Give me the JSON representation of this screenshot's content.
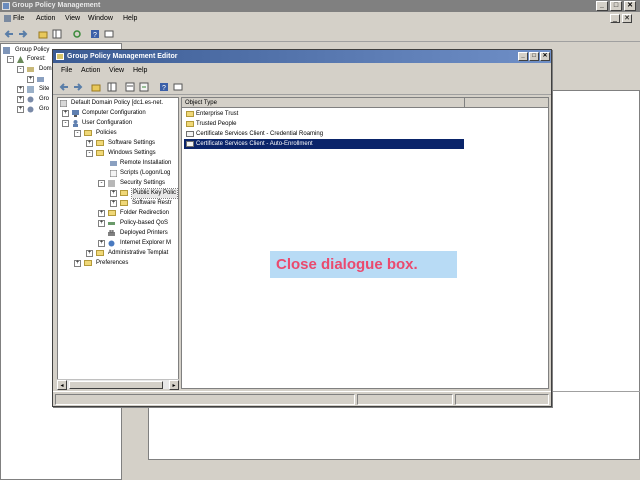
{
  "outer_window": {
    "title": "Group Policy Management",
    "caption_buttons": [
      "_",
      "□",
      "✕"
    ],
    "menu": [
      "File",
      "Action",
      "View",
      "Window",
      "Help"
    ],
    "tree": [
      {
        "label": "Group Policy",
        "expander": ""
      },
      {
        "label": "Forest:",
        "expander": "-"
      },
      {
        "label": "Dom",
        "expander": "-"
      },
      {
        "label": "",
        "expander": "+"
      },
      {
        "label": "Site",
        "expander": "+"
      },
      {
        "label": "Gro",
        "expander": "+"
      },
      {
        "label": "Gro",
        "expander": "+"
      }
    ]
  },
  "editor": {
    "title": "Group Policy Management Editor",
    "caption_buttons": [
      "_",
      "□",
      "✕"
    ],
    "menu": [
      "File",
      "Action",
      "View",
      "Help"
    ],
    "tree": [
      {
        "label": "Default Domain Policy [dc1.es-net.",
        "expander": ""
      },
      {
        "label": "Computer Configuration",
        "expander": "+"
      },
      {
        "label": "User Configuration",
        "expander": "-"
      },
      {
        "label": "Policies",
        "expander": "-"
      },
      {
        "label": "Software Settings",
        "expander": "+"
      },
      {
        "label": "Windows Settings",
        "expander": "-"
      },
      {
        "label": "Remote Installation",
        "expander": ""
      },
      {
        "label": "Scripts (Logon/Log",
        "expander": ""
      },
      {
        "label": "Security Settings",
        "expander": "-"
      },
      {
        "label": "Public Key Polic",
        "expander": "+"
      },
      {
        "label": "Software Restr",
        "expander": "+"
      },
      {
        "label": "Folder Redirection",
        "expander": "+"
      },
      {
        "label": "Policy-based QoS",
        "expander": "+"
      },
      {
        "label": "Deployed Printers",
        "expander": ""
      },
      {
        "label": "Internet Explorer M",
        "expander": "+"
      },
      {
        "label": "Administrative Templat",
        "expander": "+"
      },
      {
        "label": "Preferences",
        "expander": "+"
      }
    ],
    "list_header": "Object Type",
    "list_items": [
      "Enterprise Trust",
      "Trusted People",
      "Certificate Services Client - Credential Roaming",
      "Certificate Services Client - Auto-Enrollment"
    ],
    "selected_list_item_index": 3
  },
  "callout": {
    "text": "Close dialogue box."
  },
  "colors": {
    "title_active": "#3b5b93",
    "selection": "#0a246a",
    "callout_bg": "#b8dbf5",
    "callout_text": "#ea4a6e"
  }
}
